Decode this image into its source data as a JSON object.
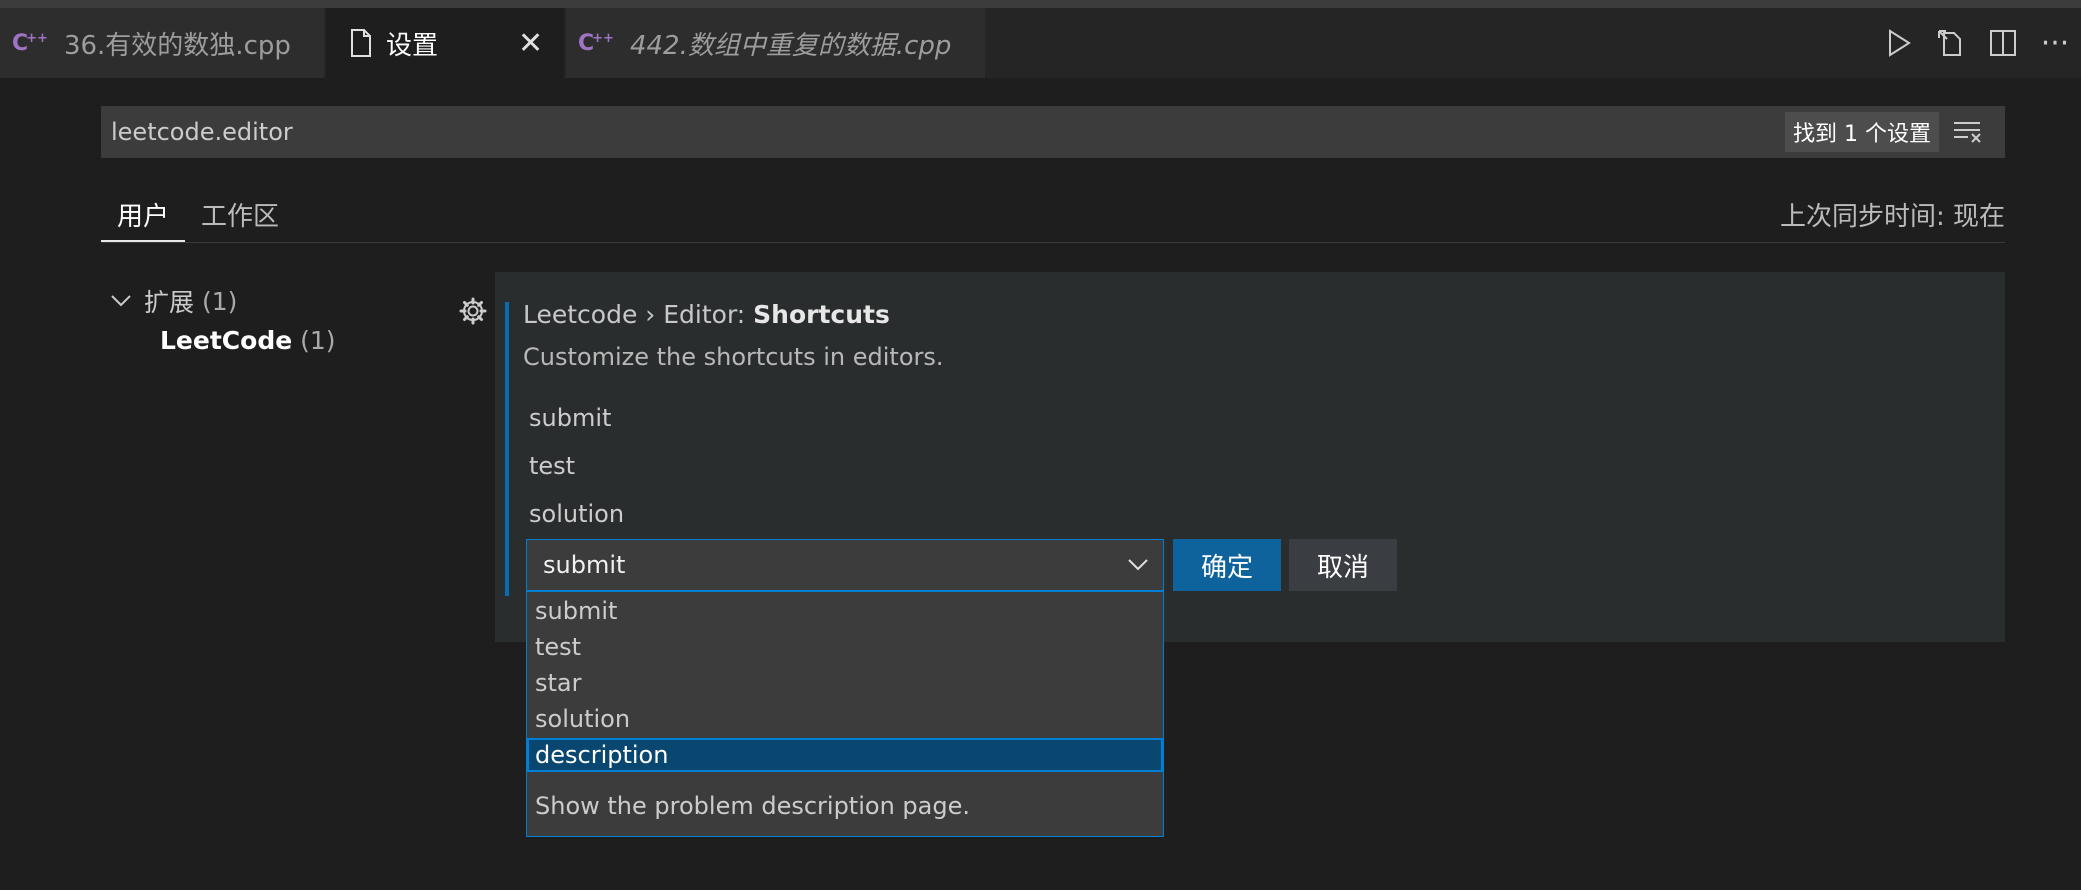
{
  "tabs": [
    {
      "label": "36.有效的数独.cpp",
      "icon": "cpp-icon",
      "active": false
    },
    {
      "label": "设置",
      "icon": "file-icon",
      "active": true,
      "close": "✕"
    },
    {
      "label": "442.数组中重复的数据.cpp",
      "icon": "cpp-icon",
      "active": false,
      "italic": true
    }
  ],
  "toolbar_icons": [
    "run-icon",
    "open-preview-icon",
    "split-editor-icon",
    "more-icon"
  ],
  "search": {
    "value": "leetcode.editor",
    "result_count": "找到 1 个设置"
  },
  "scope_tabs": {
    "user": "用户",
    "workspace": "工作区"
  },
  "sync": "上次同步时间: 现在",
  "toc": {
    "extensions_label": "扩展",
    "extensions_count": "(1)",
    "leetcode_label": "LeetCode",
    "leetcode_count": "(1)"
  },
  "setting": {
    "category": "Leetcode › Editor: ",
    "name": "Shortcuts",
    "description": "Customize the shortcuts in editors.",
    "items": [
      "submit",
      "test",
      "solution"
    ]
  },
  "editor": {
    "selected": "submit",
    "ok_label": "确定",
    "cancel_label": "取消"
  },
  "dropdown": {
    "options": [
      "submit",
      "test",
      "star",
      "solution",
      "description"
    ],
    "highlighted": "description",
    "option_description": "Show the problem description page."
  },
  "colors": {
    "background": "#1e1e1e",
    "accent": "#007acc",
    "primary_button": "#0e639c",
    "selection": "#094771",
    "cpp_icon": "#a074c4"
  }
}
